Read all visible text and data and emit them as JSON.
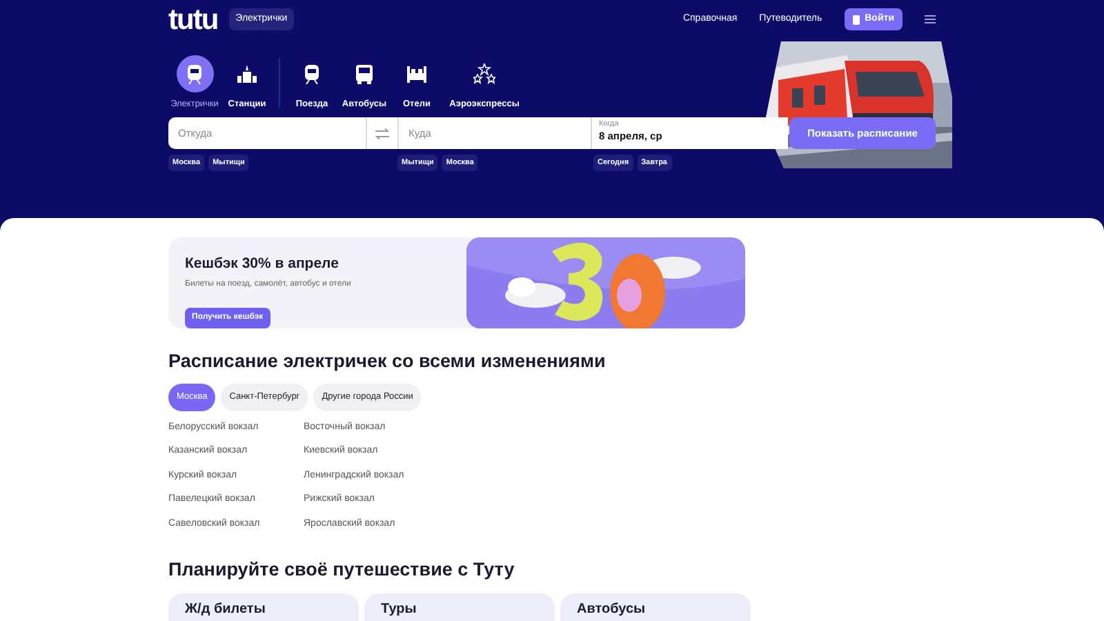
{
  "header": {
    "logo": "tutu",
    "section_badge": "Электрички",
    "links": [
      "Справочная",
      "Путеводитель"
    ],
    "login_button": "Войти"
  },
  "modes": [
    {
      "label": "Электрички",
      "selected": true
    },
    {
      "label": "Станции",
      "selected": false
    },
    {
      "label": "Поезда",
      "selected": false
    },
    {
      "label": "Автобусы",
      "selected": false
    },
    {
      "label": "Отели",
      "selected": false
    },
    {
      "label": "Аэроэкспрессы",
      "selected": false
    }
  ],
  "search": {
    "from": {
      "placeholder": "Откуда",
      "chips": [
        "Москва",
        "Мытищи"
      ]
    },
    "to": {
      "placeholder": "Куда",
      "chips": [
        "Мытищи",
        "Москва"
      ]
    },
    "when": {
      "label": "Когда",
      "value": "8 апреля, ср",
      "chips": [
        "Сегодня",
        "Завтра"
      ]
    },
    "button": "Показать расписание"
  },
  "promo": {
    "title": "Кешбэк 30% в апреле",
    "subtitle": "Билеты на поезд, самолёт, автобус и отели",
    "button": "Получить кешбэк"
  },
  "schedule": {
    "title": "Расписание электричек со всеми изменениями",
    "cities": [
      {
        "label": "Москва",
        "selected": true
      },
      {
        "label": "Санкт-Петербург",
        "selected": false
      },
      {
        "label": "Другие города России",
        "selected": false
      }
    ],
    "stations": [
      [
        "Белорусский вокзал",
        "Казанский вокзал",
        "Курский вокзал",
        "Павелецкий вокзал",
        "Савеловский вокзал"
      ],
      [
        "Восточный вокзал",
        "Киевский вокзал",
        "Ленинградский вокзал",
        "Рижский вокзал",
        "Ярославский вокзал"
      ]
    ]
  },
  "plan": {
    "title": "Планируйте своё путешествие с Туту",
    "cards": [
      "Ж/д билеты",
      "Туры",
      "Автобусы"
    ]
  }
}
